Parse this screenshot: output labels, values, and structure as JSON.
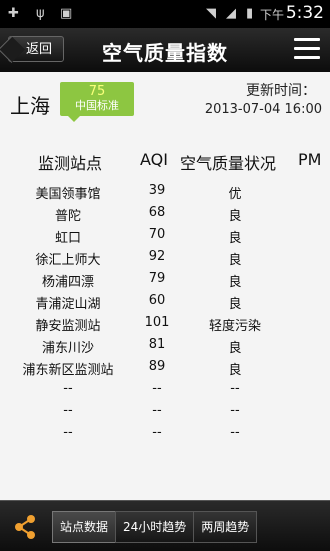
{
  "status_bar": {
    "ampm": "下午",
    "time": "5:32"
  },
  "header": {
    "back_label": "返回",
    "title": "空气质量指数"
  },
  "location": {
    "city": "上海",
    "aqi": "75",
    "standard": "中国标准",
    "update_label": "更新时间：",
    "update_value": "2013-07-04 16:00"
  },
  "table": {
    "headers": {
      "station": "监测站点",
      "aqi": "AQI",
      "quality": "空气质量状况",
      "pm": "PM"
    },
    "rows": [
      {
        "station": "美国领事馆",
        "aqi": "39",
        "quality": "优"
      },
      {
        "station": "普陀",
        "aqi": "68",
        "quality": "良"
      },
      {
        "station": "虹口",
        "aqi": "70",
        "quality": "良"
      },
      {
        "station": "徐汇上师大",
        "aqi": "92",
        "quality": "良"
      },
      {
        "station": "杨浦四漂",
        "aqi": "79",
        "quality": "良"
      },
      {
        "station": "青浦淀山湖",
        "aqi": "60",
        "quality": "良"
      },
      {
        "station": "静安监测站",
        "aqi": "101",
        "quality": "轻度污染"
      },
      {
        "station": "浦东川沙",
        "aqi": "81",
        "quality": "良"
      },
      {
        "station": "浦东新区监测站",
        "aqi": "89",
        "quality": "良"
      },
      {
        "station": "--",
        "aqi": "--",
        "quality": "--"
      },
      {
        "station": "--",
        "aqi": "--",
        "quality": "--"
      },
      {
        "station": "--",
        "aqi": "--",
        "quality": "--"
      }
    ]
  },
  "bottom_tabs": {
    "tab1": "站点数据",
    "tab2": "24小时趋势",
    "tab3": "两周趋势"
  },
  "colors": {
    "badge": "#8dc641",
    "background": "#f4f4f4"
  }
}
